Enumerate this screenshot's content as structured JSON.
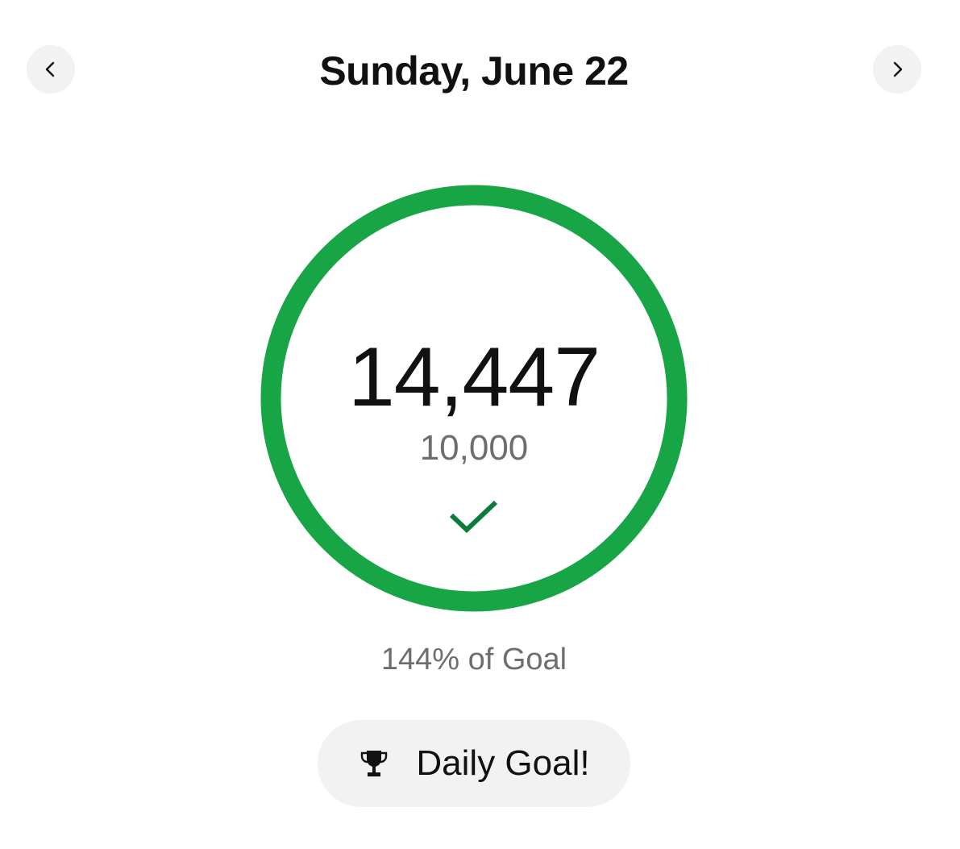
{
  "header": {
    "date_title": "Sunday, June 22",
    "prev_icon": "chevron-left-icon",
    "next_icon": "chevron-right-icon"
  },
  "progress": {
    "steps": "14,447",
    "goal": "10,000",
    "percent_text": "144% of Goal",
    "completion_fraction": 1.0,
    "status_icon": "checkmark-icon",
    "ring_color": "#17a546",
    "check_color": "#0b7d3a"
  },
  "badge": {
    "icon": "trophy-icon",
    "label": "Daily Goal!"
  }
}
